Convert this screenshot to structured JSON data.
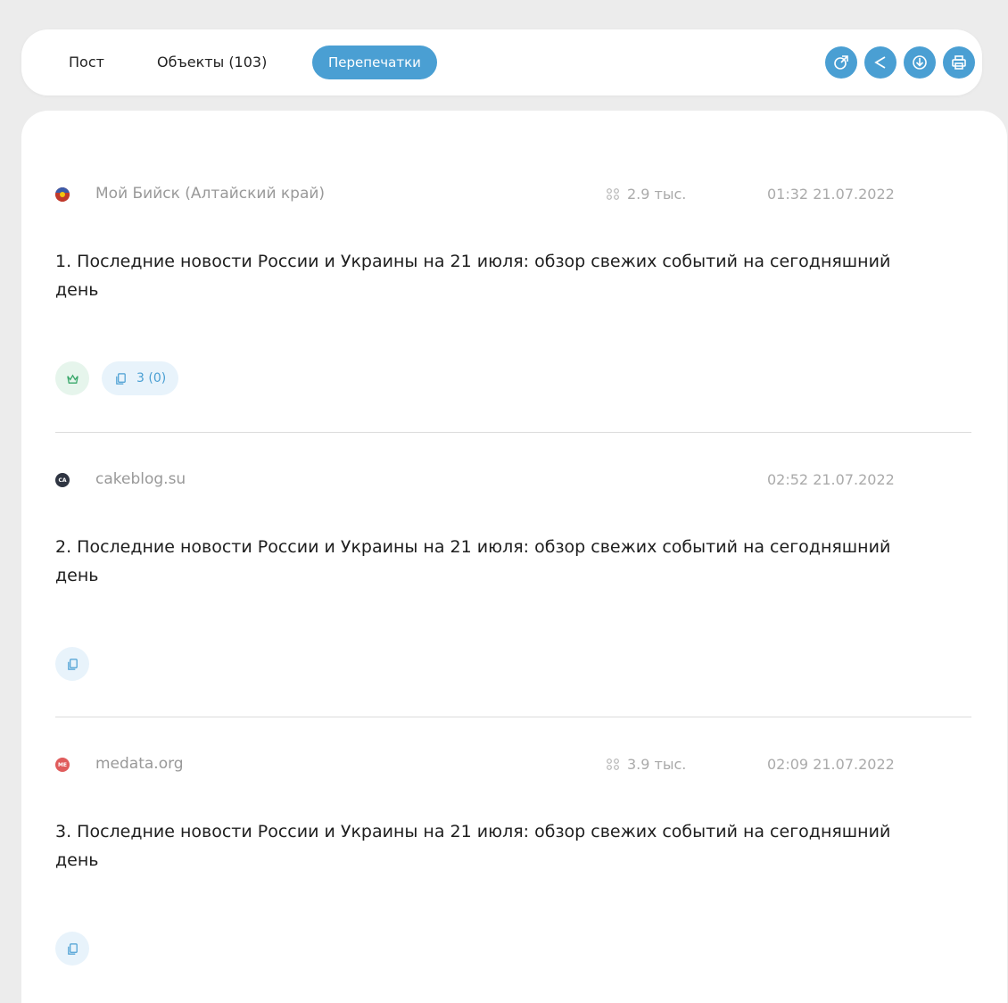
{
  "tabs": {
    "post": "Пост",
    "objects": "Объекты (103)",
    "reprints": "Перепечатки"
  },
  "colors": {
    "accent": "#4a9fd3",
    "crown_bg": "#e6f5ec",
    "crown_fg": "#3aa86b"
  },
  "actions": [
    "external-link-icon",
    "share-icon",
    "download-icon",
    "print-icon"
  ],
  "items": [
    {
      "source": "Мой Бийск (Алтайский край)",
      "audience": "2.9 тыс.",
      "date": "01:32 21.07.2022",
      "title": "1. Последние новости России и Украины на 21 июля: обзор свежих событий на сегодняшний день",
      "copies": "3 (0)",
      "favicon_color": "#c0392b"
    },
    {
      "source": "cakeblog.su",
      "date": "02:52 21.07.2022",
      "title": "2. Последние новости России и Украины на 21 июля: обзор свежих событий на сегодняшний день",
      "favicon_text": "CA",
      "favicon_color": "#2f3542"
    },
    {
      "source": "medata.org",
      "audience": "3.9 тыс.",
      "date": "02:09 21.07.2022",
      "title": "3. Последние новости России и Украины на 21 июля: обзор свежих событий на сегодняшний день",
      "favicon_text": "ME",
      "favicon_color": "#e05c5c"
    }
  ]
}
